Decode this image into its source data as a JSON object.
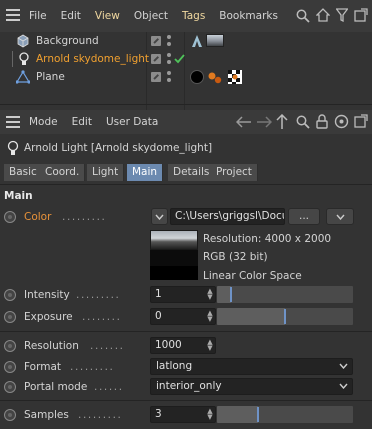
{
  "object_manager": {
    "menu": [
      "File",
      "Edit",
      "View",
      "Object",
      "Tags",
      "Bookmarks"
    ],
    "objects": [
      {
        "name": "Background",
        "color": "#d4d4d4"
      },
      {
        "name": "Arnold skydome_light",
        "color": "#f0a030"
      },
      {
        "name": "Plane",
        "color": "#d4d4d4"
      }
    ]
  },
  "attribute_manager": {
    "menu": [
      "Mode",
      "Edit",
      "User Data"
    ],
    "title": "Arnold Light [Arnold skydome_light]",
    "tabs": [
      "Basic",
      "Coord.",
      "Light",
      "Main",
      "Details",
      "Project"
    ],
    "active_tab": "Main",
    "section": "Main",
    "color": {
      "label": "Color",
      "path": "C:\\Users\\griggsl\\Docu",
      "browse_label": "...",
      "info": [
        "Resolution: 4000 x 2000",
        "RGB (32 bit)",
        "Linear Color Space"
      ]
    },
    "params": {
      "intensity": {
        "label": "Intensity",
        "value": "1",
        "slider_fraction": 0.1
      },
      "exposure": {
        "label": "Exposure",
        "value": "0",
        "slider_fraction": 0.5
      },
      "resolution": {
        "label": "Resolution",
        "value": "1000"
      },
      "format": {
        "label": "Format",
        "value": "latlong"
      },
      "portal_mode": {
        "label": "Portal mode",
        "value": "interior_only"
      },
      "samples": {
        "label": "Samples",
        "value": "3",
        "slider_fraction": 0.3
      }
    }
  },
  "colors": {
    "accent_tab": "#6c8ab0",
    "selected_object": "#f0a030",
    "color_label": "#e8923a"
  }
}
